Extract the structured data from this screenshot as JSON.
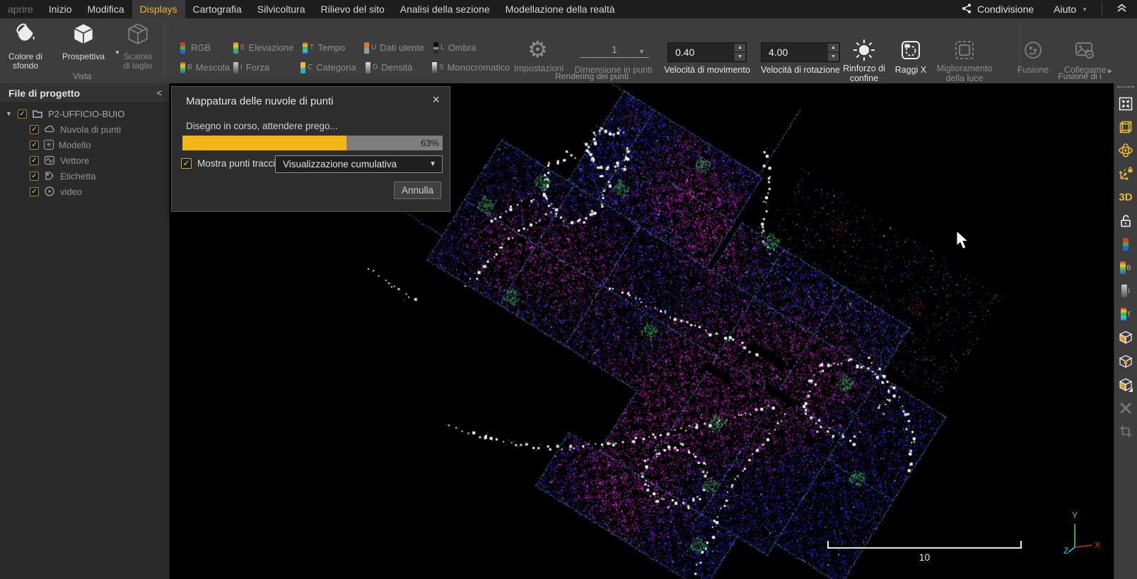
{
  "menubar": {
    "items": [
      {
        "label": "aprire",
        "state": "dim"
      },
      {
        "label": "Inizio",
        "state": "normal"
      },
      {
        "label": "Modifica",
        "state": "normal"
      },
      {
        "label": "Displays",
        "state": "active"
      },
      {
        "label": "Cartografia",
        "state": "normal"
      },
      {
        "label": "Silvicoltura",
        "state": "normal"
      },
      {
        "label": "Rilievo del sito",
        "state": "normal"
      },
      {
        "label": "Analisi della sezione",
        "state": "normal"
      },
      {
        "label": "Modellazione della realtà",
        "state": "normal"
      }
    ],
    "share_label": "Condivisione",
    "help_label": "Aiuto"
  },
  "ribbon": {
    "vista": {
      "group_label": "Vista",
      "bg_line1": "Colore di",
      "bg_line2": "sfondo",
      "perspective_label": "Prospettiva",
      "clipbox_line1": "Scatola",
      "clipbox_line2": "di taglio"
    },
    "rendering": {
      "group_label": "Rendering dei punti",
      "toggles": [
        {
          "label": "RGB",
          "letter": ""
        },
        {
          "label": "Elevazione",
          "letter": "E"
        },
        {
          "label": "Tempo",
          "letter": "T"
        },
        {
          "label": "Dati utente",
          "letter": "U"
        },
        {
          "label": "Ombra",
          "letter": "L"
        },
        {
          "label": "Mescola",
          "letter": "B"
        },
        {
          "label": "Forza",
          "letter": "I"
        },
        {
          "label": "Categoria",
          "letter": "C"
        },
        {
          "label": "Densità",
          "letter": "D"
        },
        {
          "label": "Monocromatico",
          "letter": "S"
        }
      ],
      "settings_label": "Impostazioni",
      "point_size": {
        "value": "1",
        "label": "Dimensione in punti"
      },
      "move_speed": {
        "value": "0.40",
        "label": "Velocità di movimento"
      },
      "rot_speed": {
        "value": "4.00",
        "label": "Velocità di rotazione"
      },
      "boundary_line1": "Rinforzo di",
      "boundary_line2": "confine",
      "xray_label": "Raggi X",
      "light_line1": "Miglioramento",
      "light_line2": "della luce"
    },
    "fusion": {
      "group_label": "Fusione di i",
      "fusion_label": "Fusione",
      "link_label": "Collegame"
    }
  },
  "project_panel": {
    "title": "File di progetto",
    "root_label": "P2-UFFICIO-BUIO",
    "items": [
      {
        "label": "Nuvola di punti"
      },
      {
        "label": "Modello"
      },
      {
        "label": "Vettore"
      },
      {
        "label": "Etichetta"
      },
      {
        "label": "video"
      }
    ]
  },
  "dialog": {
    "title": "Mappatura delle nuvole di punti",
    "close_glyph": "×",
    "message": "Disegno in corso, attendere prego...",
    "progress_pct": 63,
    "progress_label": "63%",
    "checkbox_label": "Mostra punti traccia",
    "dropdown_value": "Visualizzazione cumulativa",
    "cancel_label": "Annulla"
  },
  "viewport": {
    "scale_label": "10",
    "axis": {
      "x": "X",
      "y": "Y",
      "z": "Z"
    },
    "cloud_palette": {
      "blue": [
        "#1717c9",
        "#2323ee",
        "#2f2fff",
        "#12128b",
        "#4343ff",
        "#3c2ed0"
      ],
      "magenta": [
        "#d920d9",
        "#f12df1",
        "#ab16a1",
        "#8e1087",
        "#ff40f3"
      ],
      "green": [
        "#2fd25b",
        "#48e271"
      ],
      "red": [
        "#8c2121",
        "#701717"
      ],
      "wall": [
        "#3e90e2",
        "#80c8f6",
        "#2f70d2"
      ],
      "white": "#ffffff"
    }
  },
  "colors": {
    "accent_yellow": "#e9b832",
    "progress_fill": "#f3b617"
  }
}
